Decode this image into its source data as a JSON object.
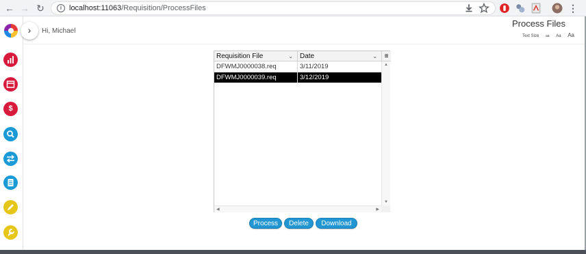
{
  "browser": {
    "url_host": "localhost:11063",
    "url_path": "/Requisition/ProcessFiles"
  },
  "header": {
    "greeting": "Hi, Michael",
    "title": "Process Files",
    "text_size_label": "Text Size",
    "text_size_options": [
      "aa",
      "Aa",
      "Aa"
    ]
  },
  "sidebar": {
    "items": [
      {
        "icon": "chart-icon",
        "color": "#d81b3c",
        "glyph": "▥"
      },
      {
        "icon": "calendar-icon",
        "color": "#d81b3c",
        "glyph": "▦"
      },
      {
        "icon": "dollar-icon",
        "color": "#d81b3c",
        "glyph": "$"
      },
      {
        "icon": "search-icon",
        "color": "#1a9bd6",
        "glyph": "⌕"
      },
      {
        "icon": "transfer-icon",
        "color": "#1a9bd6",
        "glyph": "⇄"
      },
      {
        "icon": "document-icon",
        "color": "#1a9bd6",
        "glyph": "▤"
      },
      {
        "icon": "pencil-icon",
        "color": "#e6c619",
        "glyph": "✎"
      },
      {
        "icon": "wrench-icon",
        "color": "#e6c619",
        "glyph": "🔧"
      }
    ]
  },
  "grid": {
    "columns": [
      "Requisition File",
      "Date"
    ],
    "rows": [
      {
        "file": "DFWMJ0000038.req",
        "date": "3/11/2019",
        "selected": false
      },
      {
        "file": "DFWMJ0000039.req",
        "date": "3/12/2019",
        "selected": true
      }
    ]
  },
  "actions": {
    "process": "Process",
    "delete": "Delete",
    "download": "Download"
  },
  "colors": {
    "button": "#2196d3",
    "selected_row": "#000000",
    "accent_red": "#d81b3c",
    "accent_blue": "#1a9bd6",
    "accent_yellow": "#e6c619"
  }
}
